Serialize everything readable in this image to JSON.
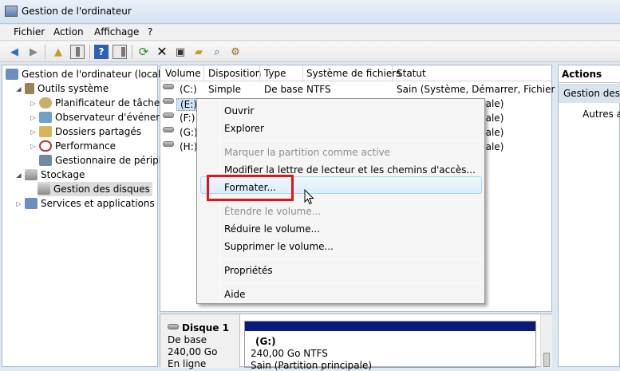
{
  "window": {
    "title": "Gestion de l'ordinateur"
  },
  "menu": [
    "Fichier",
    "Action",
    "Affichage",
    "?"
  ],
  "toolbar": {
    "icons": [
      "back-arrow-icon",
      "forward-arrow-icon",
      "up-folder-icon",
      "show-hide-tree-icon",
      "help-icon",
      "show-hide-action-pane-icon",
      "refresh-icon",
      "delete-icon",
      "properties-icon",
      "open-icon",
      "search-icon",
      "export-icon"
    ]
  },
  "tree": {
    "items": [
      {
        "label": "Gestion de l'ordinateur (local)",
        "expander": "",
        "icon_color": "#6b8fc0"
      },
      {
        "label": "Outils système",
        "expander": "◢",
        "icon_color": "#9a8055"
      },
      {
        "label": "Planificateur de tâches",
        "expander": "▷",
        "icon_color": "#c9b06a"
      },
      {
        "label": "Observateur d'événeme",
        "expander": "▷",
        "icon_color": "#6fa0c6"
      },
      {
        "label": "Dossiers partagés",
        "expander": "▷",
        "icon_color": "#d6b45a"
      },
      {
        "label": "Performance",
        "expander": "▷",
        "icon_color": "#b33a3a"
      },
      {
        "label": "Gestionnaire de périphé",
        "expander": "",
        "icon_color": "#708aa6"
      },
      {
        "label": "Stockage",
        "expander": "◢",
        "icon_color": "#8a8a8a"
      },
      {
        "label": "Gestion des disques",
        "expander": "",
        "icon_color": "#8a8a8a"
      },
      {
        "label": "Services et applications",
        "expander": "▷",
        "icon_color": "#6b8fc0"
      }
    ]
  },
  "volumes": {
    "headers": [
      "Volume",
      "Disposition",
      "Type",
      "Système de fichiers",
      "Statut"
    ],
    "rows": [
      {
        "volume": "(C:)",
        "layout": "Simple",
        "type": "De base",
        "fs": "NTFS",
        "status": "Sain (Système, Démarrer, Fichier d'éc"
      },
      {
        "volume": "(E:)",
        "layout": "",
        "type": "",
        "fs": "",
        "status": "pale)"
      },
      {
        "volume": "(F:)",
        "layout": "",
        "type": "",
        "fs": "",
        "status": "pale)"
      },
      {
        "volume": "(G:)",
        "layout": "",
        "type": "",
        "fs": "",
        "status": "pale)"
      },
      {
        "volume": "(H:)",
        "layout": "",
        "type": "",
        "fs": "",
        "status": "pale)"
      }
    ]
  },
  "disk": {
    "name": "Disque 1",
    "kind": "De base",
    "size": "240,00 Go",
    "state": "En ligne",
    "partition_letter": "(G:)",
    "partition_size": "240,00 Go NTFS",
    "partition_status": "Sain (Partition principale)"
  },
  "actions": {
    "header": "Actions",
    "section": "Gestion des d",
    "item": "Autres ac"
  },
  "context_menu": {
    "items": [
      {
        "label": "Ouvrir",
        "enabled": true
      },
      {
        "label": "Explorer",
        "enabled": true
      },
      {
        "label": "Marquer la partition comme active",
        "enabled": false
      },
      {
        "label": "Modifier la lettre de lecteur et les chemins d'accès...",
        "enabled": true
      },
      {
        "label": "Formater...",
        "enabled": true
      },
      {
        "label": "Étendre le volume...",
        "enabled": false
      },
      {
        "label": "Réduire le volume...",
        "enabled": true
      },
      {
        "label": "Supprimer le volume...",
        "enabled": true
      },
      {
        "label": "Propriétés",
        "enabled": true
      },
      {
        "label": "Aide",
        "enabled": true
      }
    ],
    "highlighted": "Formater..."
  },
  "colors": {
    "highlight_box": "#e2141a",
    "disk_bar": "#0a1a7a",
    "selection": "#cce4f7"
  }
}
